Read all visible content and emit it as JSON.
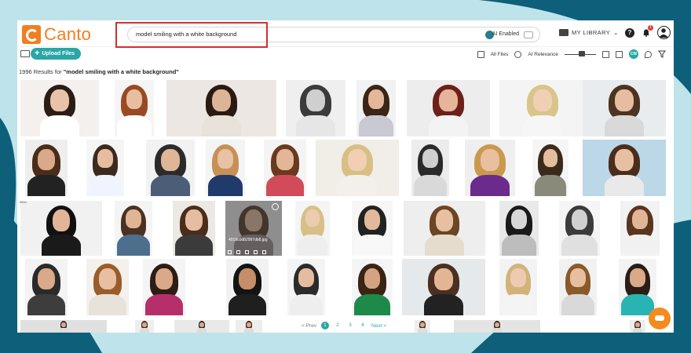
{
  "app": {
    "logo_text": "Canto"
  },
  "search": {
    "query": "model smiling with a white background",
    "ai_label": "AI Enabled"
  },
  "header": {
    "library_label": "MY LIBRARY",
    "notification_count": "1"
  },
  "toolbar": {
    "upload_label": "Upload Files",
    "filter_label": "All Files",
    "sort_label": "AI Relevance",
    "view_label": "CM"
  },
  "results": {
    "count_prefix": "1996 Results for",
    "query_quoted": "\"model smiling with a white background\""
  },
  "hover": {
    "filename": "4019c0d82997db8.jpg"
  },
  "labels": {
    "tile_label": "Bitter"
  },
  "pagination": {
    "prev": "< Prev",
    "pages": [
      "1",
      "2",
      "3",
      "4"
    ],
    "next": "Next >"
  },
  "colors": {
    "accent": "#2aa6a6",
    "brand": "#f07f22",
    "bg_dark": "#0d5f7a",
    "bg_light": "#bfe3ea",
    "highlight": "#d32f2f"
  }
}
